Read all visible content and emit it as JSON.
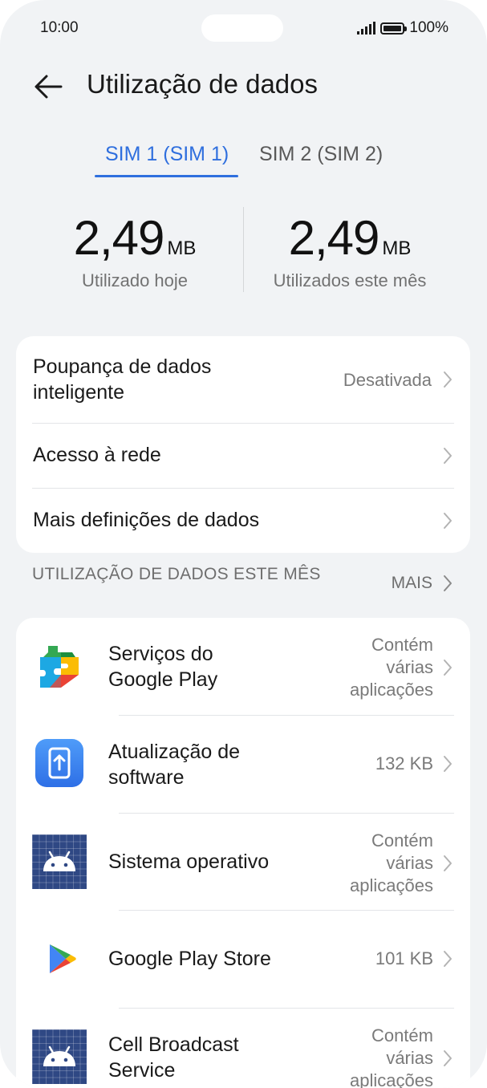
{
  "status_bar": {
    "time": "10:00",
    "battery": "100%"
  },
  "header": {
    "title": "Utilização de dados"
  },
  "tabs": [
    {
      "label": "SIM 1 (SIM 1)",
      "active": true
    },
    {
      "label": "SIM 2 (SIM 2)",
      "active": false
    }
  ],
  "usage": {
    "today": {
      "value": "2,49",
      "unit": "MB",
      "caption": "Utilizado hoje"
    },
    "month": {
      "value": "2,49",
      "unit": "MB",
      "caption": "Utilizados este mês"
    }
  },
  "settings": [
    {
      "label": "Poupança de dados inteligente",
      "value": "Desativada"
    },
    {
      "label": "Acesso à rede",
      "value": ""
    },
    {
      "label": "Mais definições de dados",
      "value": ""
    }
  ],
  "section": {
    "title": "UTILIZAÇÃO DE DADOS ESTE MÊS",
    "more": "MAIS"
  },
  "apps": [
    {
      "name": "Serviços do Google Play",
      "usage": "Contém várias aplicações",
      "icon": "google-play-services-icon"
    },
    {
      "name": "Atualização de software",
      "usage": "132 KB",
      "icon": "software-update-icon"
    },
    {
      "name": "Sistema operativo",
      "usage": "Contém várias aplicações",
      "icon": "android-icon"
    },
    {
      "name": "Google Play Store",
      "usage": "101 KB",
      "icon": "google-play-store-icon"
    },
    {
      "name": "Cell Broadcast Service",
      "usage": "Contém várias aplicações",
      "icon": "android-icon"
    }
  ],
  "colors": {
    "accent": "#2f6fde",
    "background": "#f1f3f5",
    "card": "#ffffff"
  }
}
